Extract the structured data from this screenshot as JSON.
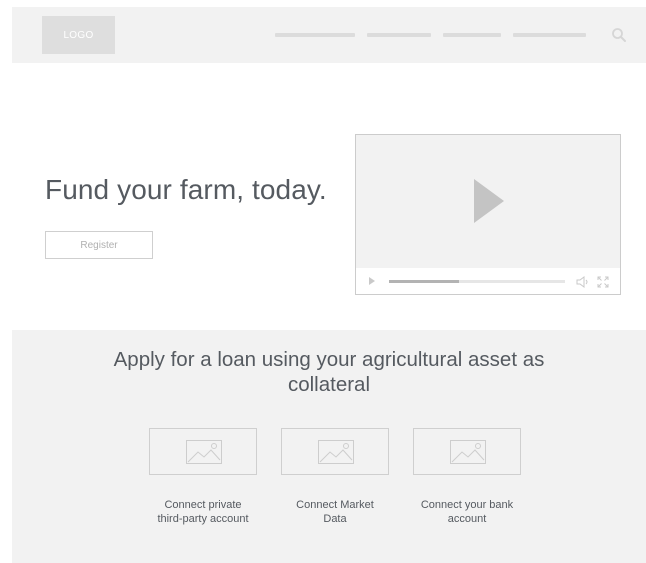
{
  "header": {
    "logo_text": "LOGO",
    "nav_items": [
      "",
      "",
      "",
      ""
    ]
  },
  "hero": {
    "headline": "Fund your farm, today.",
    "register_label": "Register"
  },
  "video": {
    "progress": 0.4
  },
  "features": {
    "title_line1": "Apply for a loan using your agricultural asset as",
    "title_line2": "collateral",
    "cards": [
      {
        "label_line1": "Connect private",
        "label_line2": "third-party account"
      },
      {
        "label_line1": "Connect Market",
        "label_line2": "Data"
      },
      {
        "label_line1": "Connect your bank",
        "label_line2": "account"
      }
    ]
  },
  "colors": {
    "placeholder_bg": "#f2f2f2",
    "text": "#555a60",
    "border": "#cfcfcf"
  },
  "icons": [
    "search-icon",
    "play-icon",
    "volume-icon",
    "fullscreen-icon",
    "image-placeholder-icon"
  ]
}
